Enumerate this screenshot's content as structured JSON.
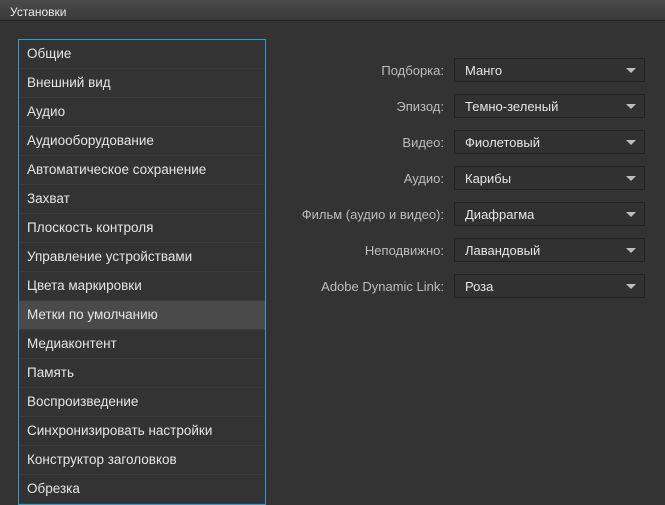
{
  "window": {
    "title": "Установки"
  },
  "sidebar": {
    "items": [
      {
        "label": "Общие"
      },
      {
        "label": "Внешний вид"
      },
      {
        "label": "Аудио"
      },
      {
        "label": "Аудиооборудование"
      },
      {
        "label": "Автоматическое сохранение"
      },
      {
        "label": "Захват"
      },
      {
        "label": "Плоскость контроля"
      },
      {
        "label": "Управление устройствами"
      },
      {
        "label": "Цвета маркировки"
      },
      {
        "label": "Метки по умолчанию"
      },
      {
        "label": "Медиаконтент"
      },
      {
        "label": "Память"
      },
      {
        "label": "Воспроизведение"
      },
      {
        "label": "Синхронизировать настройки"
      },
      {
        "label": "Конструктор заголовков"
      },
      {
        "label": "Обрезка"
      }
    ],
    "selected_index": 9
  },
  "form": {
    "rows": [
      {
        "label": "Подборка:",
        "value": "Манго"
      },
      {
        "label": "Эпизод:",
        "value": "Темно-зеленый"
      },
      {
        "label": "Видео:",
        "value": "Фиолетовый"
      },
      {
        "label": "Аудио:",
        "value": "Карибы"
      },
      {
        "label": "Фильм (аудио и видео):",
        "value": "Диафрагма"
      },
      {
        "label": "Неподвижно:",
        "value": "Лавандовый"
      },
      {
        "label": "Adobe Dynamic Link:",
        "value": "Роза"
      }
    ]
  }
}
